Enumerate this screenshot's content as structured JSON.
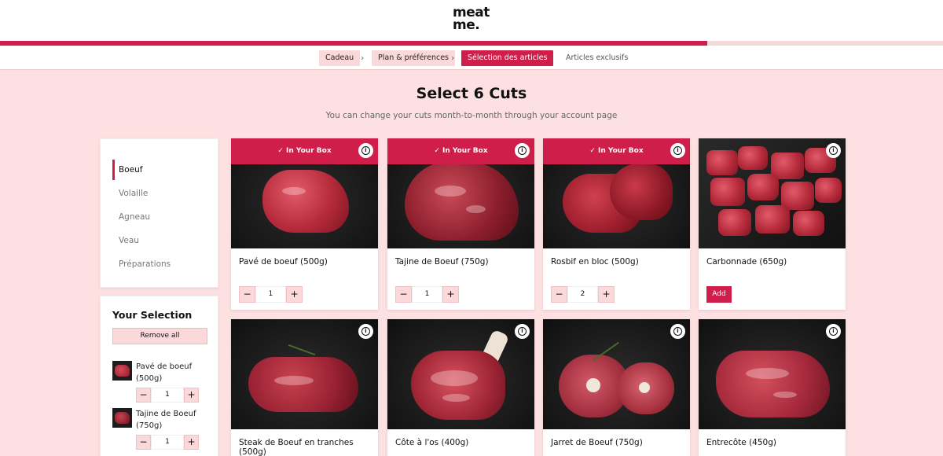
{
  "brand": {
    "logo_line1": "meat",
    "logo_line2": "me."
  },
  "progress": {
    "fraction": 0.75
  },
  "breadcrumb": [
    {
      "label": "Cadeau",
      "state": "done"
    },
    {
      "label": "Plan & préférences",
      "state": "done"
    },
    {
      "label": "Sélection des articles",
      "state": "active"
    },
    {
      "label": "Articles exclusifs",
      "state": "todo"
    }
  ],
  "heading": {
    "title": "Select 6 Cuts",
    "subtitle": "You can change your cuts month-to-month through your account page"
  },
  "categories": [
    {
      "label": "Boeuf",
      "active": true
    },
    {
      "label": "Volaille",
      "active": false
    },
    {
      "label": "Agneau",
      "active": false
    },
    {
      "label": "Veau",
      "active": false
    },
    {
      "label": "Préparations",
      "active": false
    }
  ],
  "selection": {
    "title": "Your Selection",
    "remove_all_label": "Remove all",
    "items": [
      {
        "name": "Pavé de boeuf (500g)",
        "qty": "1"
      },
      {
        "name": "Tajine de Boeuf (750g)",
        "qty": "1"
      }
    ]
  },
  "products": [
    {
      "name": "Pavé de boeuf (500g)",
      "in_box": true,
      "qty": "1"
    },
    {
      "name": "Tajine de Boeuf (750g)",
      "in_box": true,
      "qty": "1"
    },
    {
      "name": "Rosbif en bloc (500g)",
      "in_box": true,
      "qty": "2"
    },
    {
      "name": "Carbonnade (650g)",
      "in_box": false,
      "qty": ""
    },
    {
      "name": "Steak de Boeuf en tranches (500g)",
      "in_box": false,
      "qty": ""
    },
    {
      "name": "Côte à l'os (400g)",
      "in_box": false,
      "qty": ""
    },
    {
      "name": "Jarret de Boeuf (750g)",
      "in_box": false,
      "qty": ""
    },
    {
      "name": "Entrecôte (450g)",
      "in_box": false,
      "qty": ""
    }
  ],
  "labels": {
    "in_your_box": "In Your Box",
    "add": "Add",
    "minus": "−",
    "plus": "+",
    "check": "✓",
    "info": "i"
  },
  "colors": {
    "accent": "#d01e4b",
    "page_bg": "#fde0e1",
    "soft_pink": "#fbd9db"
  }
}
